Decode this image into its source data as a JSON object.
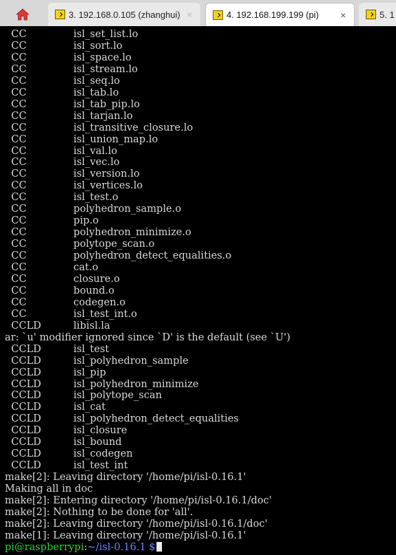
{
  "tabs": [
    {
      "label": "3. 192.168.0.105 (zhanghui)",
      "close": "×",
      "active": false
    },
    {
      "label": "4. 192.168.199.199 (pi)",
      "close": "×",
      "active": true
    },
    {
      "label": "5. 1",
      "close": "",
      "active": false
    }
  ],
  "terminal": {
    "lines": [
      {
        "a": "  CC",
        "b": "isl_set_list.lo"
      },
      {
        "a": "  CC",
        "b": "isl_sort.lo"
      },
      {
        "a": "  CC",
        "b": "isl_space.lo"
      },
      {
        "a": "  CC",
        "b": "isl_stream.lo"
      },
      {
        "a": "  CC",
        "b": "isl_seq.lo"
      },
      {
        "a": "  CC",
        "b": "isl_tab.lo"
      },
      {
        "a": "  CC",
        "b": "isl_tab_pip.lo"
      },
      {
        "a": "  CC",
        "b": "isl_tarjan.lo"
      },
      {
        "a": "  CC",
        "b": "isl_transitive_closure.lo"
      },
      {
        "a": "  CC",
        "b": "isl_union_map.lo"
      },
      {
        "a": "  CC",
        "b": "isl_val.lo"
      },
      {
        "a": "  CC",
        "b": "isl_vec.lo"
      },
      {
        "a": "  CC",
        "b": "isl_version.lo"
      },
      {
        "a": "  CC",
        "b": "isl_vertices.lo"
      },
      {
        "a": "  CC",
        "b": "isl_test.o"
      },
      {
        "a": "  CC",
        "b": "polyhedron_sample.o"
      },
      {
        "a": "  CC",
        "b": "pip.o"
      },
      {
        "a": "  CC",
        "b": "polyhedron_minimize.o"
      },
      {
        "a": "  CC",
        "b": "polytope_scan.o"
      },
      {
        "a": "  CC",
        "b": "polyhedron_detect_equalities.o"
      },
      {
        "a": "  CC",
        "b": "cat.o"
      },
      {
        "a": "  CC",
        "b": "closure.o"
      },
      {
        "a": "  CC",
        "b": "bound.o"
      },
      {
        "a": "  CC",
        "b": "codegen.o"
      },
      {
        "a": "  CC",
        "b": "isl_test_int.o"
      },
      {
        "a": "  CCLD",
        "b": "libisl.la"
      },
      {
        "a": "ar: `u' modifier ignored since `D' is the default (see `U')",
        "b": ""
      },
      {
        "a": "  CCLD",
        "b": "isl_test"
      },
      {
        "a": "  CCLD",
        "b": "isl_polyhedron_sample"
      },
      {
        "a": "  CCLD",
        "b": "isl_pip"
      },
      {
        "a": "  CCLD",
        "b": "isl_polyhedron_minimize"
      },
      {
        "a": "  CCLD",
        "b": "isl_polytope_scan"
      },
      {
        "a": "  CCLD",
        "b": "isl_cat"
      },
      {
        "a": "  CCLD",
        "b": "isl_polyhedron_detect_equalities"
      },
      {
        "a": "  CCLD",
        "b": "isl_closure"
      },
      {
        "a": "  CCLD",
        "b": "isl_bound"
      },
      {
        "a": "  CCLD",
        "b": "isl_codegen"
      },
      {
        "a": "  CCLD",
        "b": "isl_test_int"
      },
      {
        "a": "make[2]: Leaving directory '/home/pi/isl-0.16.1'",
        "b": ""
      },
      {
        "a": "Making all in doc",
        "b": ""
      },
      {
        "a": "make[2]: Entering directory '/home/pi/isl-0.16.1/doc'",
        "b": ""
      },
      {
        "a": "make[2]: Nothing to be done for 'all'.",
        "b": ""
      },
      {
        "a": "make[2]: Leaving directory '/home/pi/isl-0.16.1/doc'",
        "b": ""
      },
      {
        "a": "make[1]: Leaving directory '/home/pi/isl-0.16.1'",
        "b": ""
      }
    ],
    "prompt": {
      "user": "pi@raspberrypi",
      "sep": ":",
      "path": "~/isl-0.16.1 $"
    }
  },
  "colors": {
    "prompt_user": "#2fd12f",
    "prompt_path": "#6a88ff",
    "text": "#d9d9d9",
    "background": "#000000",
    "home_icon": "#d83a3a"
  }
}
